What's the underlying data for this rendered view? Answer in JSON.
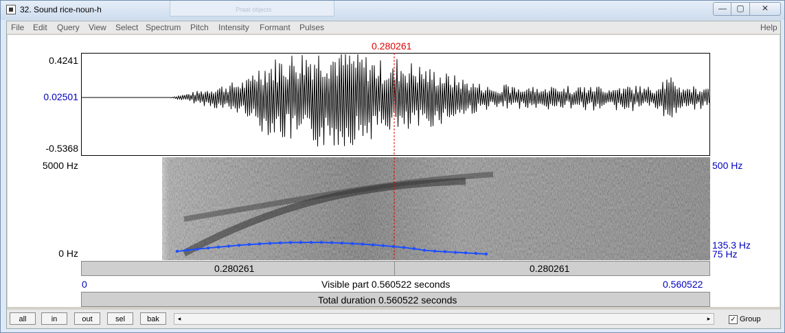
{
  "window": {
    "title": "32. Sound rice-noun-h",
    "background_tab_title": "Praat objects",
    "controls": {
      "minimize": "—",
      "maximize": "▢",
      "close": "✕"
    }
  },
  "menu": {
    "items": [
      "File",
      "Edit",
      "Query",
      "View",
      "Select",
      "Spectrum",
      "Pitch",
      "Intensity",
      "Formant",
      "Pulses"
    ],
    "help": "Help"
  },
  "cursor": {
    "time_label": "0.280261",
    "time_seconds": 0.280261
  },
  "waveform": {
    "max_label": "0.4241",
    "zero_label": "0.02501",
    "min_label": "-0.5368"
  },
  "spectrogram": {
    "top_label": "5000 Hz",
    "bottom_label": "0 Hz",
    "pitch_top_label": "500 Hz",
    "pitch_value_label": "135.3 Hz",
    "pitch_bottom_label": "75 Hz"
  },
  "selection_bar": {
    "left_label": "0.280261",
    "right_label": "0.280261"
  },
  "visible_bar": {
    "start": "0",
    "label": "Visible part 0.560522 seconds",
    "end": "0.560522"
  },
  "total_bar": {
    "label": "Total duration 0.560522 seconds"
  },
  "buttons": {
    "all": "all",
    "in": "in",
    "out": "out",
    "sel": "sel",
    "bak": "bak"
  },
  "scrollbar": {
    "left_arrow": "◂",
    "right_arrow": "▸"
  },
  "group": {
    "label": "Group",
    "checked": true,
    "check_glyph": "✓"
  },
  "colors": {
    "cursor": "#e00000",
    "pitch": "#1e4fff",
    "axis_labels": "#0000c0"
  }
}
